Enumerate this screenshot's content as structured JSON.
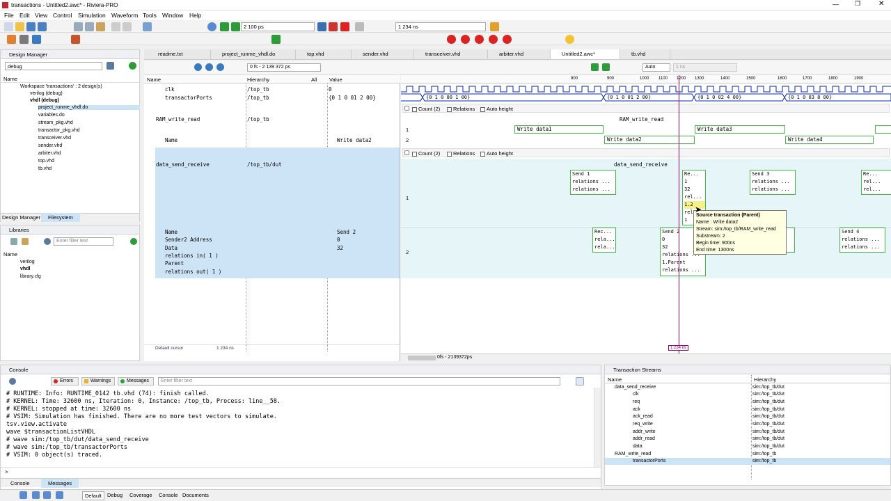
{
  "window_title": "transactions - Untitled2.awc* - Riviera-PRO",
  "menu": [
    "File",
    "Edit",
    "View",
    "Control",
    "Simulation",
    "Waveform",
    "Tools",
    "Window",
    "Help"
  ],
  "toolbar": {
    "run_for": "2 100 ps",
    "time": "1 234 ns"
  },
  "design_manager": {
    "title": "Design Manager",
    "dropdown": "debug",
    "col_name": "Name",
    "items": [
      "Workspace 'transactions' : 2 design(s)",
      "verilog (debug)",
      "vhdl (debug)",
      "project_runme_vhdl.do",
      "variables.do",
      "stream_pkg.vhd",
      "transactor_pkg.vhd",
      "transceiver.vhd",
      "sender.vhd",
      "arbiter.vhd",
      "top.vhd",
      "tb.vhd"
    ],
    "tabs": [
      "Design Manager",
      "Filesystem"
    ]
  },
  "libraries": {
    "title": "Libraries",
    "filter_placeholder": "Enter filter text",
    "col_name": "Name",
    "items": [
      "verilog",
      "vhdl",
      "library.cfg"
    ]
  },
  "editor_tabs": [
    "readme.txt",
    "project_runme_vhdl.do",
    "top.vhd",
    "sender.vhd",
    "transceiver.vhd",
    "arbiter.vhd",
    "Untitled2.awc*",
    "tb.vhd"
  ],
  "wave_toolbar": {
    "range": "0 fs - 2 139 372 ps",
    "mode": "Auto",
    "unit": "1 ns"
  },
  "wave": {
    "cols": {
      "name": "Name",
      "hierarchy": "Hierarchy",
      "filter": "All",
      "value": "Value"
    },
    "signals": [
      {
        "name": "clk",
        "hier": "/top_tb",
        "value": "0"
      },
      {
        "name": "transactorPorts",
        "hier": "/top_tb",
        "value": "{0 1 0 01 2 00}"
      },
      {
        "name": "RAM_write_read",
        "hier": "/top_tb",
        "value": ""
      },
      {
        "name": "Name",
        "hier": "",
        "value": "Write data2"
      },
      {
        "name": "data_send_receive",
        "hier": "/top_tb/dut",
        "value": ""
      }
    ],
    "detail_names": [
      "Name",
      "Sender2 Address",
      "Data",
      "relations in( 1 )",
      "Parent",
      "relations out( 1 )"
    ],
    "detail_values": [
      "Send 2",
      "0",
      "32"
    ],
    "cursor_label": "Default cursor",
    "cursor_value": "1 234 ns",
    "cursor_flag": "1 234 ns",
    "scroll_range": "0fs - 2139372ps",
    "ruler": [
      "800",
      "900",
      "1000",
      "1100",
      "1200",
      "1300",
      "1400",
      "1500",
      "1600",
      "1700",
      "1800",
      "1900"
    ],
    "port_values": [
      "{0 1 0 00 1 00}",
      "{0 1 0 01 2 00}",
      "{0 1 0 02 4 00}",
      "{0 1 0 03 8 00}"
    ],
    "group_opts": {
      "count": "Count (2)",
      "relations": "Relations",
      "auto": "Auto height"
    },
    "ram_title": "RAM_write_read",
    "ram_rows": [
      "1",
      "2"
    ],
    "ram_tx": [
      "Write data1",
      "Write data3",
      "Write data2",
      "Write data4"
    ],
    "dsr_title": "data_send_receive",
    "dsr_rows": [
      "1",
      "2"
    ],
    "tx_send1": [
      "Send 1",
      "relations ...",
      "relations ..."
    ],
    "tx_re1": [
      "Re...",
      "1",
      "32",
      "rel...",
      "1.2",
      "rel...",
      "1"
    ],
    "tx_send3": [
      "Send 3",
      "relations ...",
      "relations ..."
    ],
    "tx_right1": [
      "Re...",
      "rel...",
      "rel..."
    ],
    "tx_rec": [
      "Rec...",
      "rela...",
      "rela..."
    ],
    "tx_send2": [
      "Send 2",
      "0",
      "32",
      "relations ...",
      "1.Parent",
      "relations ..."
    ],
    "tx_mid2": [
      "...",
      "...",
      "..."
    ],
    "tx_send4": [
      "Send 4",
      "relations ...",
      "relations ..."
    ],
    "tooltip": {
      "title": "Source transaction (Parent)",
      "lines": [
        "Name : Write data2",
        "Stream: sim:/top_tb/RAM_write_read",
        "Substream: 2",
        "Begin time: 900ns",
        "End time: 1300ns"
      ]
    }
  },
  "console": {
    "title": "Console",
    "buttons": [
      "Errors",
      "Warnings",
      "Messages"
    ],
    "filter_placeholder": "Enter filter text",
    "lines": [
      "# RUNTIME: Info: RUNTIME_0142 tb.vhd (74): finish called.",
      "# KERNEL: Time: 32600 ns,  Iteration: 0,  Instance: /top_tb,  Process: line__58.",
      "# KERNEL: stopped at time: 32600 ns",
      "# VSIM: Simulation has finished. There are no more test vectors to simulate.",
      "tsv.view.activate",
      "wave $transactionListVHDL",
      "# wave sim:/top_tb/dut/data_send_receive",
      "# wave sim:/top_tb/transactorPorts",
      "# VSIM: 0 object(s) traced."
    ],
    "prompt": ">",
    "tabs": [
      "Console",
      "Messages"
    ]
  },
  "streams": {
    "title": "Transaction Streams",
    "col_name": "Name",
    "col_hier": "Hierarchy",
    "rows": [
      {
        "name": "data_send_receive",
        "hier": "sim:/top_tb/dut"
      },
      {
        "name": "clk",
        "hier": "sim:/top_tb/dut"
      },
      {
        "name": "req",
        "hier": "sim:/top_tb/dut"
      },
      {
        "name": "ack",
        "hier": "sim:/top_tb/dut"
      },
      {
        "name": "ack_read",
        "hier": "sim:/top_tb/dut"
      },
      {
        "name": "req_write",
        "hier": "sim:/top_tb/dut"
      },
      {
        "name": "addr_write",
        "hier": "sim:/top_tb/dut"
      },
      {
        "name": "addr_read",
        "hier": "sim:/top_tb/dut"
      },
      {
        "name": "data",
        "hier": "sim:/top_tb/dut"
      },
      {
        "name": "RAM_write_read",
        "hier": "sim:/top_tb"
      },
      {
        "name": "transactorPorts",
        "hier": "sim:/top_tb"
      }
    ]
  },
  "bottom_tabs": [
    "Default",
    "Debug",
    "Coverage",
    "Console",
    "Documents"
  ]
}
